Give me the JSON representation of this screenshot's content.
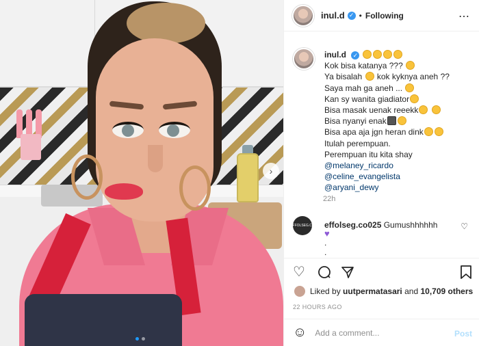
{
  "header": {
    "username": "inul.d",
    "separator": "•",
    "follow_status": "Following",
    "more_icon": "more-icon"
  },
  "caption": {
    "username": "inul.d",
    "lines": [
      "Kok bisa katanya ???",
      "Ya bisalah",
      "kok kyknya aneh ??",
      "Saya mah ga aneh ...",
      "Kan sy wanita giadiator",
      "Bisa masak uenak reeekk",
      "Bisa nyanyi enak",
      "Bisa apa aja jgn heran dink",
      "Itulah perempuan.",
      "Perempuan itu kita shay"
    ],
    "mentions": [
      "@melaney_ricardo",
      "@celine_evangelista",
      "@aryani_dewy"
    ]
  },
  "timestamp": "22h",
  "comment": {
    "avatar_text": "EFFOLSEG.CO",
    "username": "effolseg.co025",
    "text": "Gumushhhhhh",
    "dots": [
      ".",
      "."
    ]
  },
  "likes": {
    "prefix": "Liked by",
    "user": "uutpermatasari",
    "joiner": "and",
    "others": "10,709 others"
  },
  "time_ago": "22 HOURS AGO",
  "add_comment": {
    "placeholder": "Add a comment...",
    "post_label": "Post"
  },
  "colors": {
    "verified": "#3897f0",
    "mention": "#00376b",
    "post_disabled": "#b2dffc",
    "carousel_active": "#1e9bff"
  }
}
